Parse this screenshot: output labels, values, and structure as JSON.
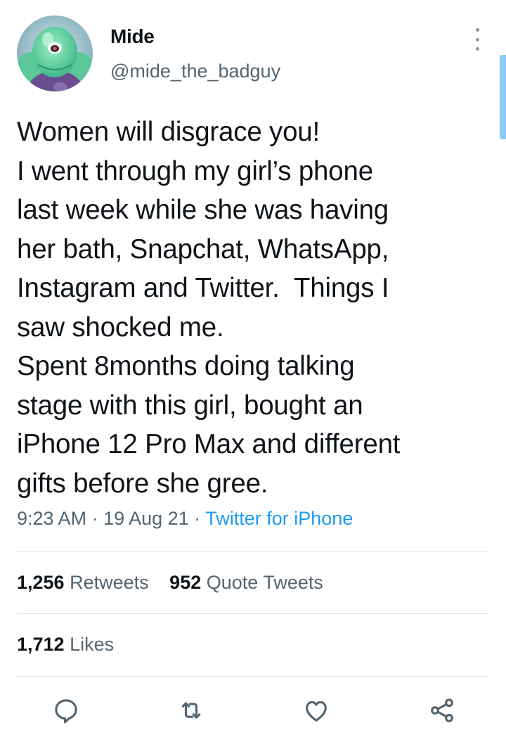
{
  "author": {
    "name": "Mide",
    "handle": "@mide_the_badguy",
    "avatar_icon": "cartoon-character-avatar"
  },
  "tweet": {
    "lines": [
      "Women will disgrace you!",
      "I went through my girl’s phone",
      "last week while she was having",
      "her bath, Snapchat, WhatsApp,",
      "Instagram and Twitter.  Things I",
      "saw shocked me.",
      "Spent 8months doing talking",
      "stage with this girl, bought an",
      "iPhone 12 Pro Max and different",
      "gifts before she gree."
    ]
  },
  "meta": {
    "time": "9:23 AM",
    "separator": "·",
    "date": "19 Aug 21",
    "source": "Twitter for iPhone"
  },
  "stats": {
    "retweets": {
      "count": "1,256",
      "label": "Retweets"
    },
    "quote_tweets": {
      "count": "952",
      "label": "Quote Tweets"
    },
    "likes": {
      "count": "1,712",
      "label": "Likes"
    }
  },
  "actions": {
    "reply_icon": "reply-icon",
    "retweet_icon": "retweet-icon",
    "like_icon": "heart-icon",
    "share_icon": "share-icon"
  },
  "colors": {
    "text": "#0f1419",
    "secondary": "#536471",
    "link": "#1d9bf0",
    "divider": "#dfe3e6"
  }
}
